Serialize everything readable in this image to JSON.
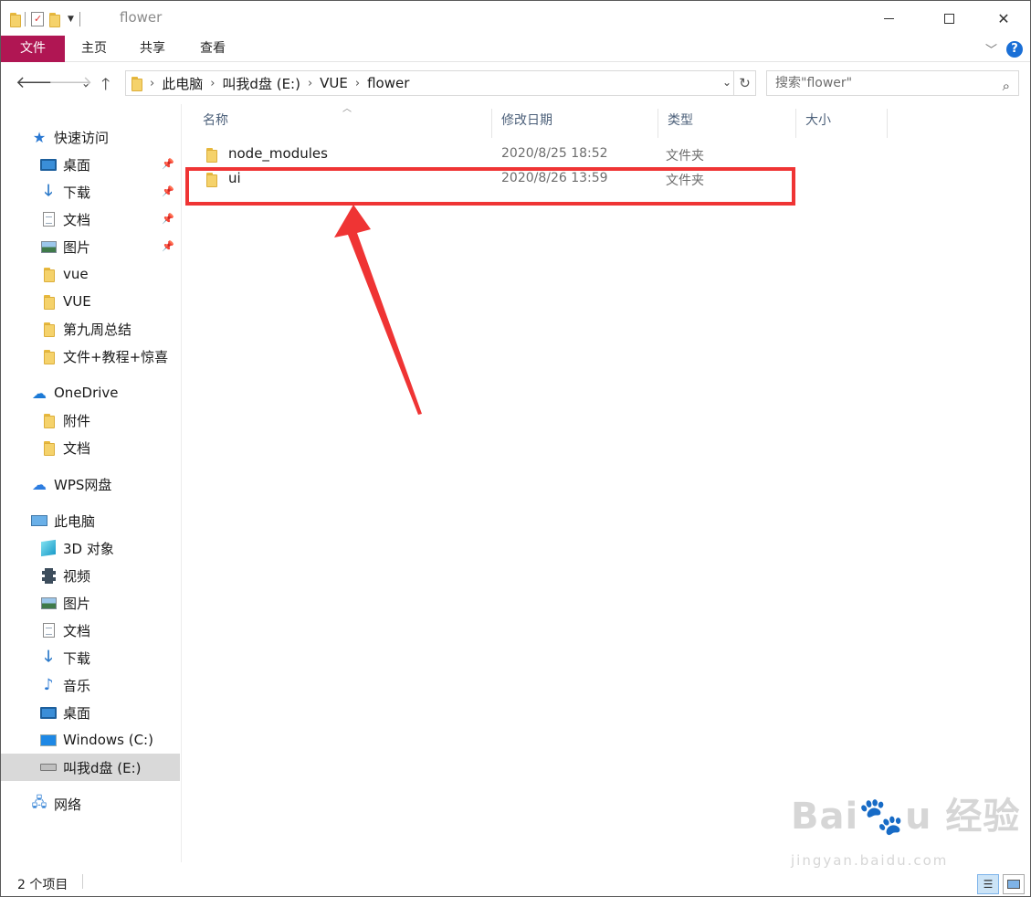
{
  "window": {
    "title": "flower",
    "controls": {
      "minimize_icon": "minimize-icon",
      "maximize_icon": "maximize-icon",
      "close_icon": "close-icon"
    }
  },
  "ribbon": {
    "tabs": [
      {
        "label": "文件",
        "active": true,
        "color": "#b01653"
      },
      {
        "label": "主页"
      },
      {
        "label": "共享"
      },
      {
        "label": "查看"
      }
    ]
  },
  "address": {
    "crumbs": [
      "此电脑",
      "叫我d盘 (E:)",
      "VUE",
      "flower"
    ]
  },
  "search": {
    "placeholder": "搜索\"flower\""
  },
  "sidebar": {
    "quick_access": {
      "label": "快速访问"
    },
    "quick_items": [
      {
        "label": "桌面",
        "icon": "desktop-icon",
        "pinned": true
      },
      {
        "label": "下载",
        "icon": "download-icon",
        "pinned": true
      },
      {
        "label": "文档",
        "icon": "document-icon",
        "pinned": true
      },
      {
        "label": "图片",
        "icon": "picture-icon",
        "pinned": true
      },
      {
        "label": "vue",
        "icon": "folder-icon"
      },
      {
        "label": "VUE",
        "icon": "folder-icon"
      },
      {
        "label": "第九周总结",
        "icon": "folder-icon"
      },
      {
        "label": "文件+教程+惊喜",
        "icon": "folder-icon"
      }
    ],
    "onedrive": {
      "label": "OneDrive"
    },
    "onedrive_items": [
      {
        "label": "附件",
        "icon": "folder-icon"
      },
      {
        "label": "文档",
        "icon": "folder-icon"
      }
    ],
    "wps": {
      "label": "WPS网盘"
    },
    "this_pc": {
      "label": "此电脑"
    },
    "pc_items": [
      {
        "label": "3D 对象",
        "icon": "3d-objects-icon"
      },
      {
        "label": "视频",
        "icon": "video-icon"
      },
      {
        "label": "图片",
        "icon": "picture-icon"
      },
      {
        "label": "文档",
        "icon": "document-icon"
      },
      {
        "label": "下载",
        "icon": "download-icon"
      },
      {
        "label": "音乐",
        "icon": "music-icon"
      },
      {
        "label": "桌面",
        "icon": "desktop-icon"
      },
      {
        "label": "Windows (C:)",
        "icon": "windows-drive-icon"
      },
      {
        "label": "叫我d盘 (E:)",
        "icon": "drive-icon",
        "selected": true
      }
    ],
    "network": {
      "label": "网络"
    }
  },
  "columns": [
    "名称",
    "修改日期",
    "类型",
    "大小"
  ],
  "files": [
    {
      "name": "node_modules",
      "modified": "2020/8/25 18:52",
      "type": "文件夹"
    },
    {
      "name": "ui",
      "modified": "2020/8/26 13:59",
      "type": "文件夹"
    }
  ],
  "status": {
    "count": "2 个项目"
  },
  "annotation": {
    "highlight_color": "#ef3434"
  },
  "watermark": {
    "text": "Bai 经验",
    "sub": "jingyan.baidu.com"
  }
}
